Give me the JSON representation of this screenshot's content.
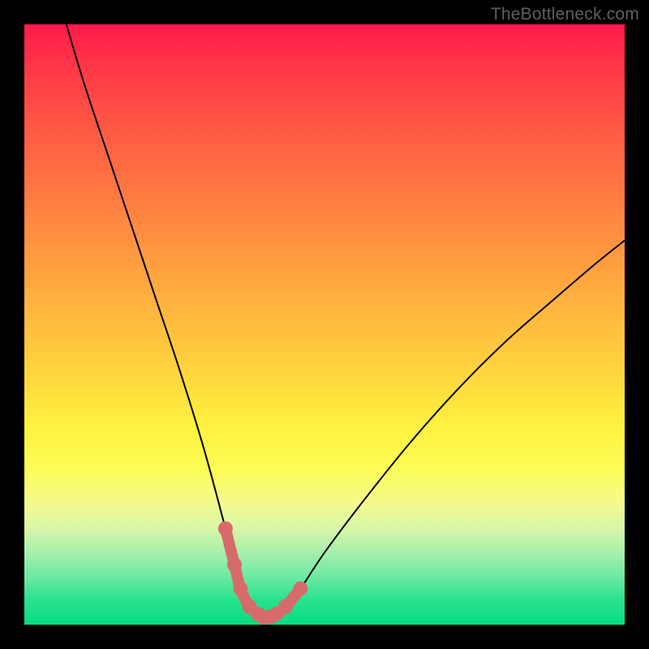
{
  "watermark": "TheBottleneck.com",
  "chart_data": {
    "type": "line",
    "title": "",
    "xlabel": "",
    "ylabel": "",
    "xlim": [
      0,
      100
    ],
    "ylim": [
      0,
      100
    ],
    "series": [
      {
        "name": "bottleneck-curve",
        "x": [
          7,
          10,
          14,
          18,
          22,
          26,
          30,
          33.5,
          35,
          36,
          37.5,
          39,
          40,
          41,
          42,
          43.5,
          46,
          50,
          56,
          64,
          72,
          80,
          88,
          95,
          100
        ],
        "values": [
          100,
          90,
          78,
          66,
          54,
          42,
          29,
          16,
          10,
          6,
          3,
          1.7,
          1.2,
          1.3,
          1.8,
          3,
          6,
          12,
          20,
          30,
          39,
          47,
          54,
          60,
          64
        ]
      },
      {
        "name": "highlight-dots",
        "x": [
          33.5,
          35,
          36,
          37.5,
          39,
          40,
          41,
          42,
          43.5,
          46
        ],
        "values": [
          16,
          10,
          6,
          3,
          1.7,
          1.2,
          1.3,
          1.8,
          3,
          6
        ]
      }
    ],
    "colors": {
      "curve": "#000000",
      "dots": "#d76b6b"
    }
  }
}
